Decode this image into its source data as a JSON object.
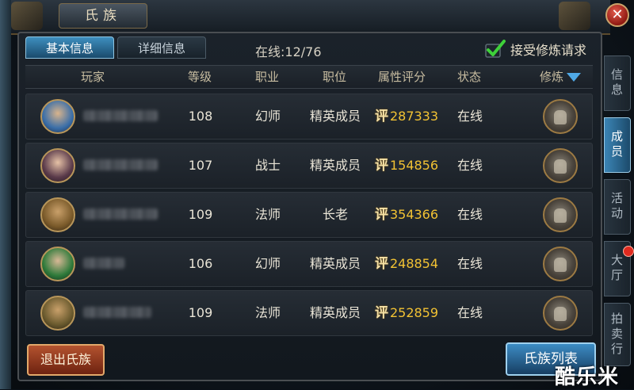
{
  "window": {
    "title": "氏族"
  },
  "tabs": [
    {
      "label": "基本信息",
      "active": true
    },
    {
      "label": "详细信息",
      "active": false
    }
  ],
  "online_status": "在线:12/76",
  "accept_training": {
    "label": "接受修炼请求",
    "checked": true
  },
  "columns": [
    "玩家",
    "等级",
    "职业",
    "职位",
    "属性评分",
    "状态",
    "修炼"
  ],
  "score_prefix": "评",
  "members": [
    {
      "level": "108",
      "class": "幻师",
      "rank": "精英成员",
      "score": "287333",
      "status": "在线"
    },
    {
      "level": "107",
      "class": "战士",
      "rank": "精英成员",
      "score": "154856",
      "status": "在线"
    },
    {
      "level": "109",
      "class": "法师",
      "rank": "长老",
      "score": "354366",
      "status": "在线"
    },
    {
      "level": "106",
      "class": "幻师",
      "rank": "精英成员",
      "score": "248854",
      "status": "在线"
    },
    {
      "level": "109",
      "class": "法师",
      "rank": "精英成员",
      "score": "252859",
      "status": "在线"
    }
  ],
  "buttons": {
    "quit": "退出氏族",
    "clan_list": "氏族列表"
  },
  "side_tabs": [
    {
      "label": "信息",
      "active": false
    },
    {
      "label": "成员",
      "active": true
    },
    {
      "label": "活动",
      "active": false
    },
    {
      "label": "大厅",
      "active": false,
      "badge": true
    },
    {
      "label": "拍卖行",
      "active": false
    }
  ],
  "watermark": "酷乐米",
  "colors": {
    "accent_blue": "#3e8fbf",
    "score_gold": "#f2c233",
    "quit_red": "#b4532f"
  }
}
